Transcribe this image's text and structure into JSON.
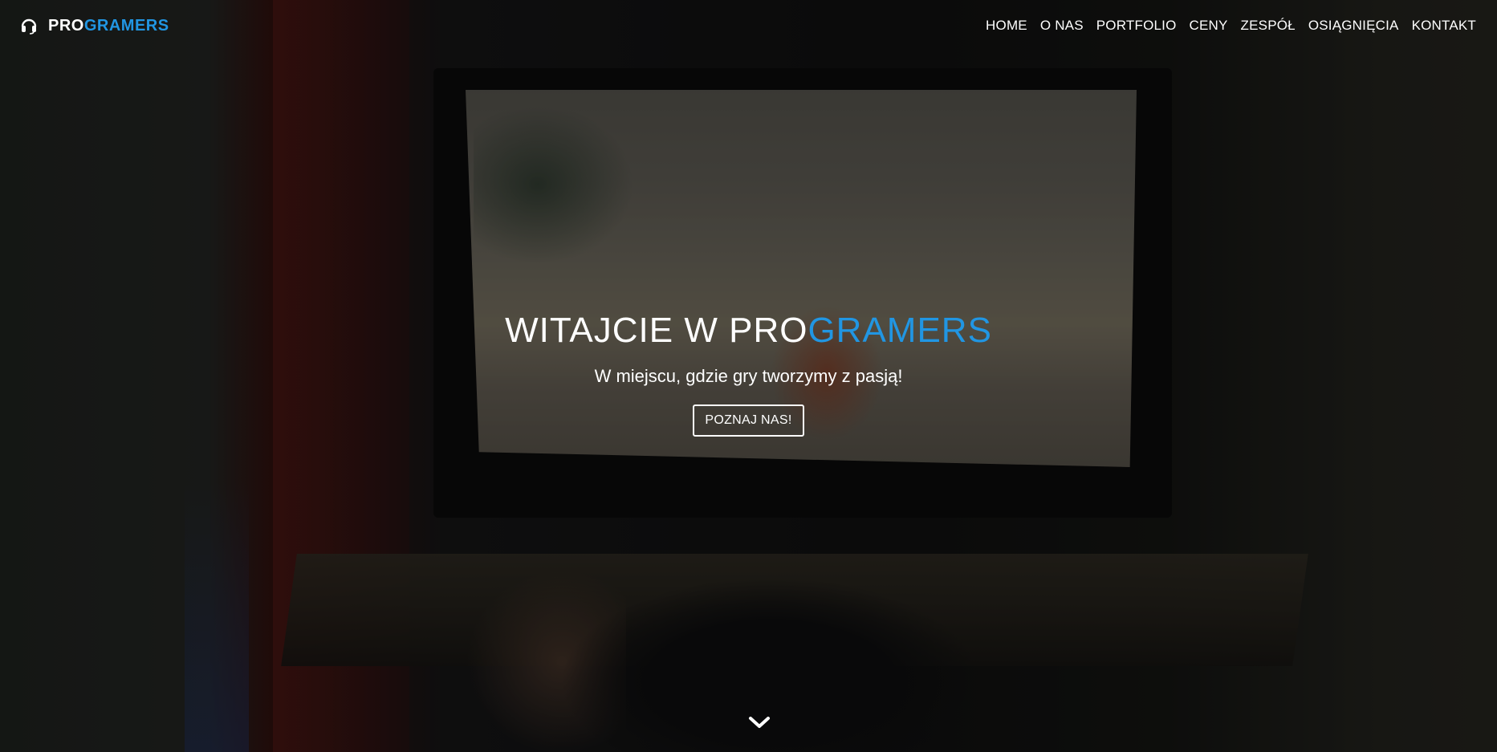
{
  "brand": {
    "pro": "PRO",
    "rest": "GRAMERS",
    "icon": "headset-icon",
    "accent_color": "#2196e3"
  },
  "nav": {
    "items": [
      {
        "label": "HOME"
      },
      {
        "label": "O NAS"
      },
      {
        "label": "PORTFOLIO"
      },
      {
        "label": "CENY"
      },
      {
        "label": "ZESPÓŁ"
      },
      {
        "label": "OSIĄGNIĘCIA"
      },
      {
        "label": "KONTAKT"
      }
    ]
  },
  "hero": {
    "title_white": "WITAJCIE W PRO",
    "title_blue": "GRAMERS",
    "subtitle": "W miejscu, gdzie gry tworzymy z pasją!",
    "button_label": "POZNAJ NAS!",
    "scroll_icon": "chevron-down-icon"
  }
}
